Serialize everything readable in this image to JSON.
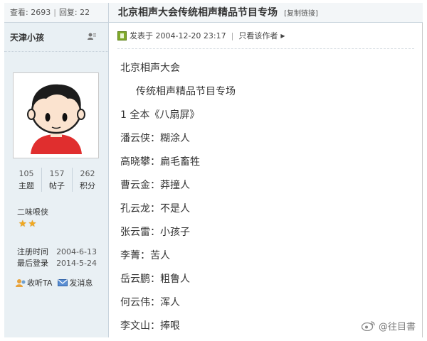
{
  "stats": {
    "views_label": "查看:",
    "views": "2693",
    "replies_label": "回复:",
    "replies": "22"
  },
  "thread": {
    "title": "北京相声大会传统相声精品节目专场",
    "copy_link": "[复制链接]"
  },
  "post_meta": {
    "posted_label": "发表于",
    "posted_at": "2004-12-20 23:17",
    "only_author": "只看该作者"
  },
  "user": {
    "name": "天津小孩",
    "counts": [
      {
        "value": "105",
        "label": "主题"
      },
      {
        "value": "157",
        "label": "帖子"
      },
      {
        "value": "262",
        "label": "积分"
      }
    ],
    "rank": "二味哏侠",
    "star_count": 2,
    "register_label": "注册时间",
    "register_date": "2004-6-13",
    "last_login_label": "最后登录",
    "last_login_date": "2014-5-24",
    "actions": {
      "follow": "收听TA",
      "message": "发消息"
    }
  },
  "post_lines": [
    "北京相声大会",
    "传统相声精品节目专场",
    "1 全本《八扇屏》",
    "潘云侠：糊涂人",
    "高晓攀：扁毛畜牲",
    "曹云金：莽撞人",
    "孔云龙：不是人",
    "张云雷：小孩子",
    "李菁：苦人",
    "岳云鹏：粗鲁人",
    "何云伟：浑人",
    "李文山：捧哏"
  ],
  "watermark": "@往目書",
  "colors": {
    "sidebar_bg": "#e9f0f4",
    "header_bg": "#f3f6f8",
    "star": "#f2a81e",
    "post_icon": "#7fa829"
  }
}
